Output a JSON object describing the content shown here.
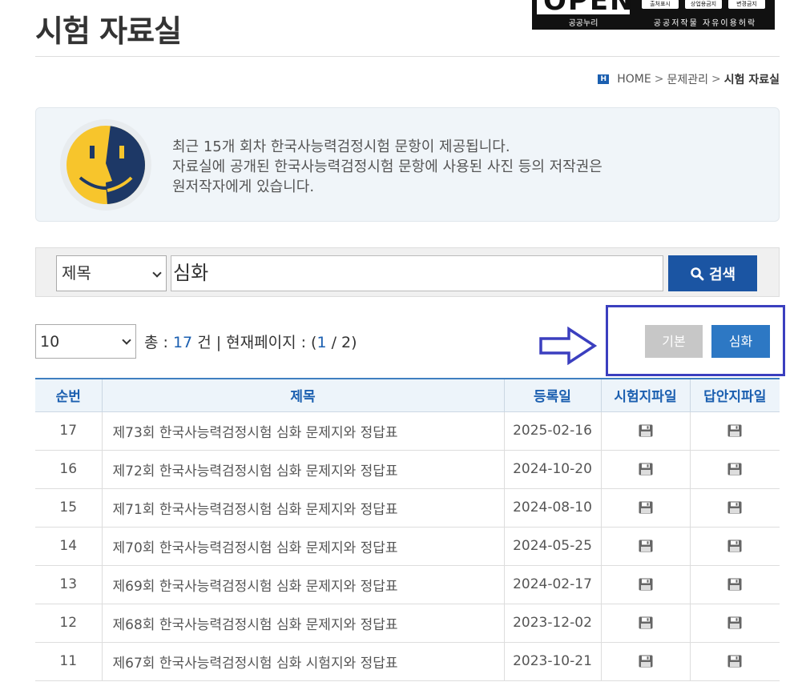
{
  "page": {
    "title": "시험 자료실"
  },
  "license": {
    "open": "OPEN",
    "gongnuri": "공공누리",
    "badges": [
      "출처표시",
      "상업용금지",
      "변경금지"
    ],
    "caption": "공공저작물 자유이용허락"
  },
  "breadcrumb": {
    "home_icon": "H",
    "home": "HOME",
    "separator": ">",
    "level1": "문제관리",
    "current": "시험 자료실"
  },
  "notice": {
    "icon": "finder-face-icon",
    "lines": [
      "최근 15개 회차 한국사능력검정시험 문항이 제공됩니다.",
      "자료실에 공개된 한국사능력검정시험 문항에 사용된 사진 등의 저작권은",
      "원저작자에게 있습니다."
    ]
  },
  "search": {
    "field_selected": "제목",
    "query": "심화",
    "button_label": "검색",
    "button_icon": "search-icon"
  },
  "listing": {
    "page_size": "10",
    "total_prefix": "총 : ",
    "total": "17",
    "total_suffix": " 건 | 현재페이지 : (",
    "current_page": "1",
    "page_sep": " / ",
    "total_pages": "2",
    "page_suffix": ")"
  },
  "filter": {
    "basic_label": "기본",
    "advanced_label": "심화"
  },
  "colors": {
    "primary": "#1b55a3",
    "accent": "#2d78c4",
    "annotation": "#3b3fbf",
    "header_text": "#1b5fb0"
  },
  "table": {
    "headers": [
      "순번",
      "제목",
      "등록일",
      "시험지파일",
      "답안지파일"
    ],
    "file_icon": "floppy-disk-icon",
    "rows": [
      {
        "no": "17",
        "title": "제73회 한국사능력검정시험 심화 문제지와 정답표",
        "date": "2025-02-16"
      },
      {
        "no": "16",
        "title": "제72회 한국사능력검정시험 심화 문제지와 정답표",
        "date": "2024-10-20"
      },
      {
        "no": "15",
        "title": "제71회 한국사능력검정시험 심화 문제지와 정답표",
        "date": "2024-08-10"
      },
      {
        "no": "14",
        "title": "제70회 한국사능력검정시험 심화 문제지와 정답표",
        "date": "2024-05-25"
      },
      {
        "no": "13",
        "title": "제69회 한국사능력검정시험 심화 문제지와 정답표",
        "date": "2024-02-17"
      },
      {
        "no": "12",
        "title": "제68회 한국사능력검정시험 심화 문제지와 정답표",
        "date": "2023-12-02"
      },
      {
        "no": "11",
        "title": "제67회 한국사능력검정시험 심화 시험지와 정답표",
        "date": "2023-10-21"
      }
    ]
  }
}
